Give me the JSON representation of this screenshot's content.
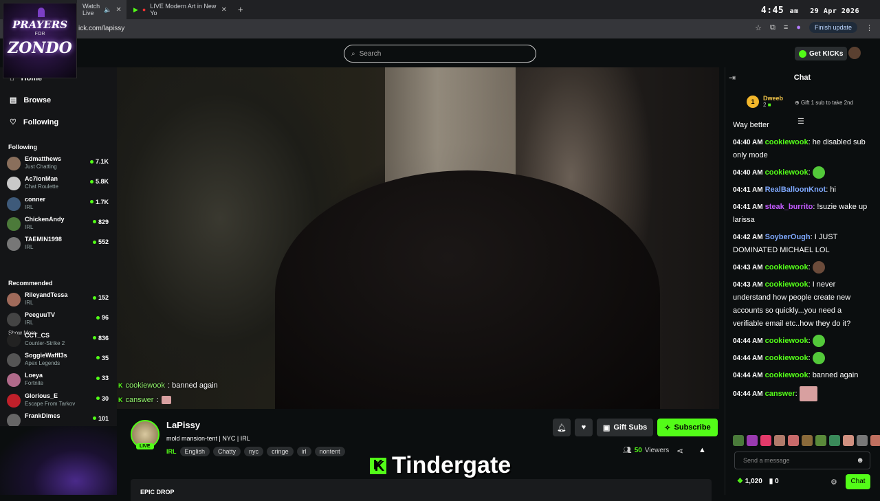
{
  "browser": {
    "tab1_label": "Watch Live",
    "tab2_label": "LIVE Modern Art in New Yo",
    "url": "ick.com/lapissy",
    "finish_update": "Finish update",
    "clock_time": "4:45",
    "clock_ampm": "am",
    "clock_date": "29 Apr 2026"
  },
  "overlay_logo": {
    "line1": "PRAYERS",
    "line2": "ZONDO",
    "small": "FOR"
  },
  "topnav": {
    "search_placeholder": "Search",
    "get_kicks": "Get KICKs"
  },
  "sidebar": {
    "nav": [
      {
        "label": "Home",
        "icon": "home-icon"
      },
      {
        "label": "Browse",
        "icon": "browse-icon"
      },
      {
        "label": "Following",
        "icon": "heart-icon"
      }
    ],
    "following_heading": "Following",
    "following": [
      {
        "name": "Edmatthews",
        "category": "Just Chatting",
        "viewers": "7.1K",
        "color": "#8a6f5c"
      },
      {
        "name": "Ac7ionMan",
        "category": "Chat Roulette",
        "viewers": "5.8K",
        "color": "#c9c9c9"
      },
      {
        "name": "conner",
        "category": "IRL",
        "viewers": "1.7K",
        "color": "#3e5a7a"
      },
      {
        "name": "ChickenAndy",
        "category": "IRL",
        "viewers": "829",
        "color": "#4c7a3a"
      },
      {
        "name": "TAEMIN1998",
        "category": "IRL",
        "viewers": "552",
        "color": "#777"
      }
    ],
    "show_more": "Show More",
    "recommended_heading": "Recommended",
    "recommended": [
      {
        "name": "RileyandTessa",
        "category": "IRL",
        "viewers": "152",
        "color": "#a06a5a"
      },
      {
        "name": "PeeguuTV",
        "category": "IRL",
        "viewers": "96",
        "color": "#444"
      },
      {
        "name": "CCT_CS",
        "category": "Counter-Strike 2",
        "viewers": "836",
        "color": "#222"
      },
      {
        "name": "SoggieWaffl3s",
        "category": "Apex Legends",
        "viewers": "35",
        "color": "#555"
      },
      {
        "name": "Loeya",
        "category": "Fortnite",
        "viewers": "33",
        "color": "#b06a8a"
      },
      {
        "name": "Glorious_E",
        "category": "Escape From Tarkov",
        "viewers": "30",
        "color": "#c0202a"
      },
      {
        "name": "FrankDimes",
        "category": "",
        "viewers": "101",
        "color": "#666"
      }
    ]
  },
  "video_overlay_chat": [
    {
      "user": "cookiewook",
      "text": ": banned again"
    },
    {
      "user": "canswer",
      "text": ":"
    }
  ],
  "stream": {
    "live_badge": "LIVE",
    "name": "LaPissy",
    "title": "mold mansion-tent | NYC | IRL",
    "category": "IRL",
    "tags": [
      "English",
      "Chatty",
      "nyc",
      "cringe",
      "irl",
      "nontent"
    ],
    "gift_subs": "Gift Subs",
    "subscribe": "Subscribe",
    "viewers_count": "50",
    "viewers_label": "Viewers",
    "panel_title": "EPIC DROP"
  },
  "caption": {
    "text": "Tindergate"
  },
  "chat": {
    "title": "Chat",
    "pinned": {
      "rank": "1",
      "name": "Dweeb",
      "count": "2",
      "gift_hint": "Gift 1 sub to take 2nd"
    },
    "cut_message": "Way better",
    "messages": [
      {
        "time": "04:40 AM",
        "user": "cookiewook",
        "color": "g",
        "text": ": he disabled sub only mode",
        "emote": ""
      },
      {
        "time": "04:40 AM",
        "user": "cookiewook",
        "color": "g",
        "text": ":",
        "emote": "green"
      },
      {
        "time": "04:41 AM",
        "user": "RealBalloonKnot",
        "color": "b",
        "text": ": hi",
        "emote": ""
      },
      {
        "time": "04:41 AM",
        "user": "steak_burrito",
        "color": "p",
        "text": ": !suzie wake up larissa",
        "emote": ""
      },
      {
        "time": "04:42 AM",
        "user": "SoyberOugh",
        "color": "b",
        "text": ": I JUST DOMINATED MICHAEL LOL",
        "emote": ""
      },
      {
        "time": "04:43 AM",
        "user": "cookiewook",
        "color": "g",
        "text": ":",
        "emote": "face"
      },
      {
        "time": "04:43 AM",
        "user": "cookiewook",
        "color": "g",
        "text": ": I never understand how people create new accounts so quickly...you need a verifiable email etc..how they do it?",
        "emote": ""
      },
      {
        "time": "04:44 AM",
        "user": "cookiewook",
        "color": "g",
        "text": ":",
        "emote": "green"
      },
      {
        "time": "04:44 AM",
        "user": "cookiewook",
        "color": "g",
        "text": ":",
        "emote": "green"
      },
      {
        "time": "04:44 AM",
        "user": "cookiewook",
        "color": "g",
        "text": ": banned again",
        "emote": ""
      },
      {
        "time": "04:44 AM",
        "user": "canswer",
        "color": "g",
        "text": ":",
        "emote": "pink"
      }
    ],
    "send_placeholder": "Send a message",
    "kicks_count": "1,020",
    "points_count": "0",
    "chat_button": "Chat"
  },
  "colors": {
    "accent": "#53fc18",
    "bg": "#0b0e0f"
  }
}
